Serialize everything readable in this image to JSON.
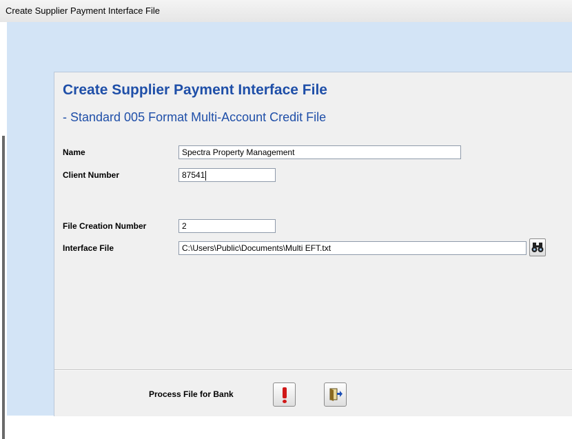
{
  "window": {
    "title": "Create Supplier Payment Interface File"
  },
  "form": {
    "heading": "Create Supplier Payment Interface File",
    "subheading": "- Standard 005 Format Multi-Account Credit File",
    "name_label": "Name",
    "name_value": "Spectra Property Management",
    "client_number_label": "Client Number",
    "client_number_value": "87541",
    "file_creation_number_label": "File Creation Number",
    "file_creation_number_value": "2",
    "interface_file_label": "Interface File",
    "interface_file_value": "C:\\Users\\Public\\Documents\\Multi EFT.txt"
  },
  "footer": {
    "process_label": "Process File for Bank"
  },
  "icons": {
    "browse": "binoculars-icon",
    "process": "exclamation-icon",
    "exit": "exit-door-icon"
  },
  "colors": {
    "heading": "#1f4fa8",
    "background": "#d3e4f6",
    "panel": "#f0f0f0",
    "process_icon": "#d01818"
  }
}
